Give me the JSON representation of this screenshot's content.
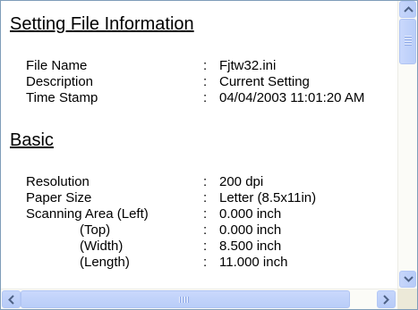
{
  "setting_file_information": {
    "heading": "Setting File Information",
    "rows": [
      {
        "label": "File Name",
        "colon": ":",
        "value": "Fjtw32.ini"
      },
      {
        "label": "Description",
        "colon": ":",
        "value": "Current Setting"
      },
      {
        "label": "Time Stamp",
        "colon": ":",
        "value": "04/04/2003 11:01:20 AM"
      }
    ]
  },
  "basic": {
    "heading": "Basic",
    "rows": [
      {
        "label": "Resolution",
        "colon": ":",
        "value": "200 dpi"
      },
      {
        "label": "Paper Size",
        "colon": ":",
        "value": "Letter (8.5x11in)"
      },
      {
        "label": "Scanning Area (Left)",
        "colon": ":",
        "value": "0.000 inch"
      },
      {
        "label": "(Top)",
        "colon": ":",
        "value": "0.000 inch"
      },
      {
        "label": "(Width)",
        "colon": ":",
        "value": "8.500 inch"
      },
      {
        "label": "(Length)",
        "colon": ":",
        "value": "11.000 inch"
      }
    ]
  },
  "icons": {
    "scroll_up": "arrow-up-icon",
    "scroll_down": "arrow-down-icon",
    "scroll_left": "arrow-left-icon",
    "scroll_right": "arrow-right-icon"
  },
  "colors": {
    "border": "#7f9db9",
    "scrollbar_track": "#fbfbf7",
    "scrollbar_button": "#c1d3fb",
    "scroll_arrow": "#4d6185"
  }
}
